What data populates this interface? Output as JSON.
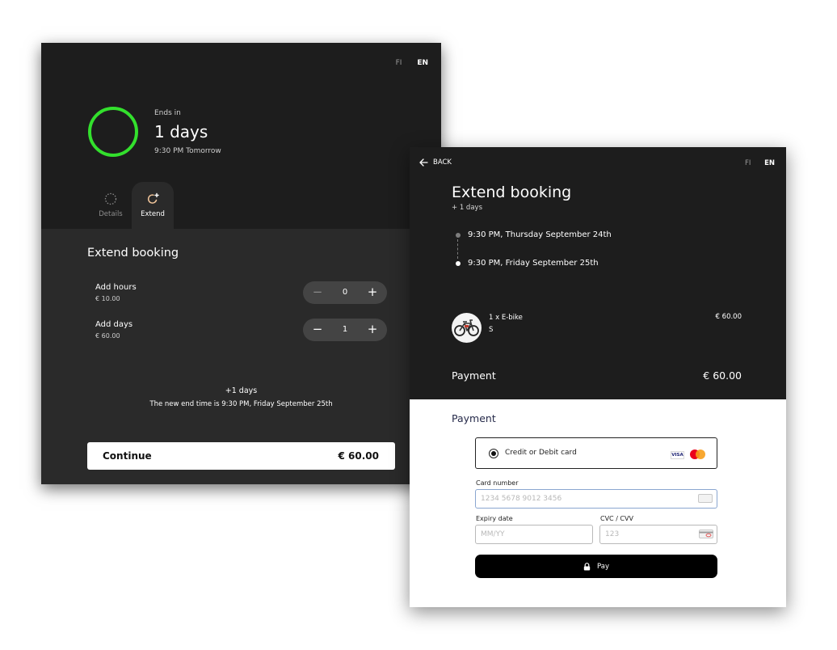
{
  "extend_screen": {
    "lang_options": [
      "FI",
      "EN"
    ],
    "ends_label": "Ends in",
    "ends_value": "1 days",
    "ends_time": "9:30 PM Tomorrow",
    "tabs": [
      {
        "label": "Details",
        "active": false,
        "icon": "dotted-circle-icon"
      },
      {
        "label": "Extend",
        "active": true,
        "icon": "refresh-plus-icon"
      }
    ],
    "section_title": "Extend booking",
    "add_hours": {
      "label": "Add hours",
      "price": "€ 10.00",
      "value": "0",
      "minus": "−",
      "plus": "+"
    },
    "add_days": {
      "label": "Add days",
      "price": "€ 60.00",
      "value": "1",
      "minus": "−",
      "plus": "+"
    },
    "summary_days": "+1 days",
    "summary_end": "The new end time is 9:30 PM, Friday September 25th",
    "continue_label": "Continue",
    "continue_price": "€ 60.00",
    "ring_color": "#33e02d"
  },
  "payment_screen": {
    "back_label": "BACK",
    "lang_options": [
      "FI",
      "EN"
    ],
    "title": "Extend booking",
    "subtitle": "+ 1 days",
    "old_end": "9:30 PM, Thursday September 24th",
    "new_end": "9:30 PM, Friday September 25th",
    "item_name": "1 x E-bike",
    "item_size": "S",
    "item_price": "€ 60.00",
    "payment_label": "Payment",
    "payment_total": "€ 60.00",
    "form_title": "Payment",
    "card_option_label": "Credit or Debit card",
    "visa_label": "VISA",
    "card_number_label": "Card number",
    "card_number_placeholder": "1234 5678 9012 3456",
    "expiry_label": "Expiry date",
    "expiry_placeholder": "MM/YY",
    "cvc_label": "CVC / CVV",
    "cvc_placeholder": "123",
    "pay_label": "Pay"
  }
}
